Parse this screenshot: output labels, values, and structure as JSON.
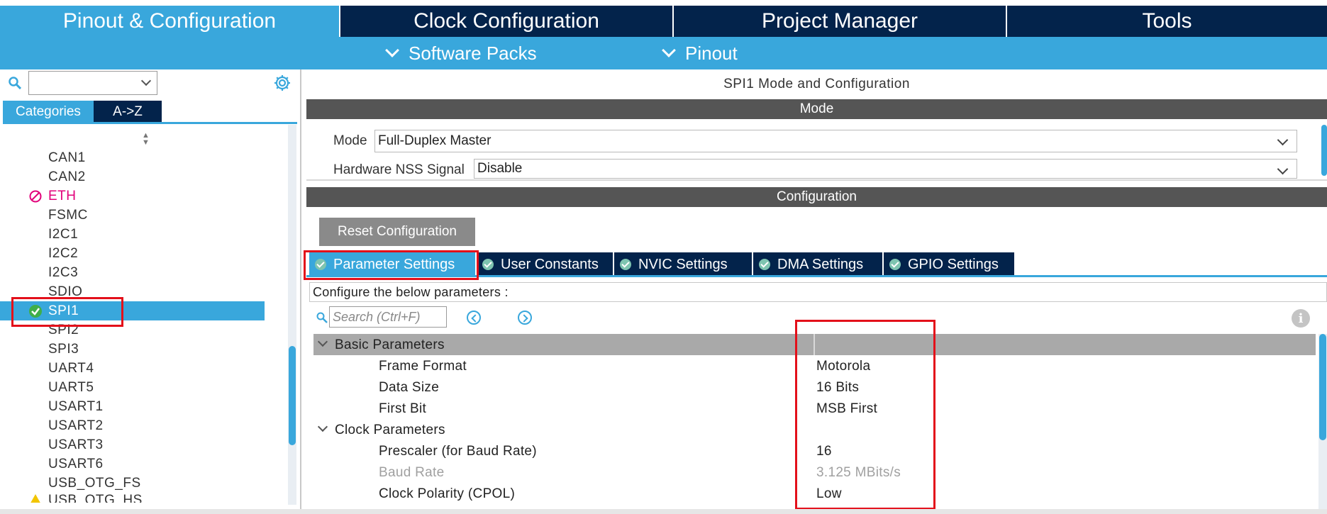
{
  "top_tabs": [
    {
      "label": "Pinout & Configuration",
      "active": true
    },
    {
      "label": "Clock Configuration",
      "active": false
    },
    {
      "label": "Project Manager",
      "active": false
    },
    {
      "label": "Tools",
      "active": false
    }
  ],
  "sub_menu": [
    {
      "label": "Software Packs"
    },
    {
      "label": "Pinout"
    }
  ],
  "left_panel": {
    "search_value": "",
    "tabs": [
      {
        "label": "Categories",
        "active": true
      },
      {
        "label": "A->Z",
        "active": false
      }
    ],
    "peripherals": [
      {
        "label": "CAN1",
        "status": "none"
      },
      {
        "label": "CAN2",
        "status": "none"
      },
      {
        "label": "ETH",
        "status": "disabled"
      },
      {
        "label": "FSMC",
        "status": "none"
      },
      {
        "label": "I2C1",
        "status": "none"
      },
      {
        "label": "I2C2",
        "status": "none"
      },
      {
        "label": "I2C3",
        "status": "none"
      },
      {
        "label": "SDIO",
        "status": "none"
      },
      {
        "label": "SPI1",
        "status": "configured",
        "selected": true
      },
      {
        "label": "SPI2",
        "status": "none"
      },
      {
        "label": "SPI3",
        "status": "none"
      },
      {
        "label": "UART4",
        "status": "none"
      },
      {
        "label": "UART5",
        "status": "none"
      },
      {
        "label": "USART1",
        "status": "none"
      },
      {
        "label": "USART2",
        "status": "none"
      },
      {
        "label": "USART3",
        "status": "none"
      },
      {
        "label": "USART6",
        "status": "none"
      },
      {
        "label": "USB_OTG_FS",
        "status": "none"
      },
      {
        "label": "USB_OTG_HS",
        "status": "warning"
      }
    ]
  },
  "right_panel": {
    "title": "SPI1 Mode and Configuration",
    "mode_band": "Mode",
    "mode_fields": [
      {
        "label": "Mode",
        "value": "Full-Duplex Master"
      },
      {
        "label": "Hardware NSS Signal",
        "value": "Disable"
      }
    ],
    "config_band": "Configuration",
    "reset_button": "Reset Configuration",
    "config_tabs": [
      {
        "label": "Parameter Settings",
        "active": true
      },
      {
        "label": "User Constants",
        "active": false
      },
      {
        "label": "NVIC Settings",
        "active": false
      },
      {
        "label": "DMA Settings",
        "active": false
      },
      {
        "label": "GPIO Settings",
        "active": false
      }
    ],
    "hint": "Configure the below parameters :",
    "search_placeholder": "Search (Ctrl+F)",
    "parameters": [
      {
        "type": "group",
        "name": "Basic Parameters",
        "shaded": true
      },
      {
        "type": "param",
        "name": "Frame Format",
        "value": "Motorola"
      },
      {
        "type": "param",
        "name": "Data Size",
        "value": "16 Bits"
      },
      {
        "type": "param",
        "name": "First Bit",
        "value": "MSB First"
      },
      {
        "type": "group",
        "name": "Clock Parameters",
        "shaded": false
      },
      {
        "type": "param",
        "name": "Prescaler (for Baud Rate)",
        "value": "16"
      },
      {
        "type": "param",
        "name": "Baud Rate",
        "value": "3.125 MBits/s",
        "disabled": true
      },
      {
        "type": "param",
        "name": "Clock Polarity (CPOL)",
        "value": "Low"
      }
    ]
  },
  "colors": {
    "accent": "#39a7dc",
    "dark_navy": "#03234b",
    "band_gray": "#555555",
    "highlight_red": "#e3101a",
    "eth_magenta": "#e2007a"
  }
}
